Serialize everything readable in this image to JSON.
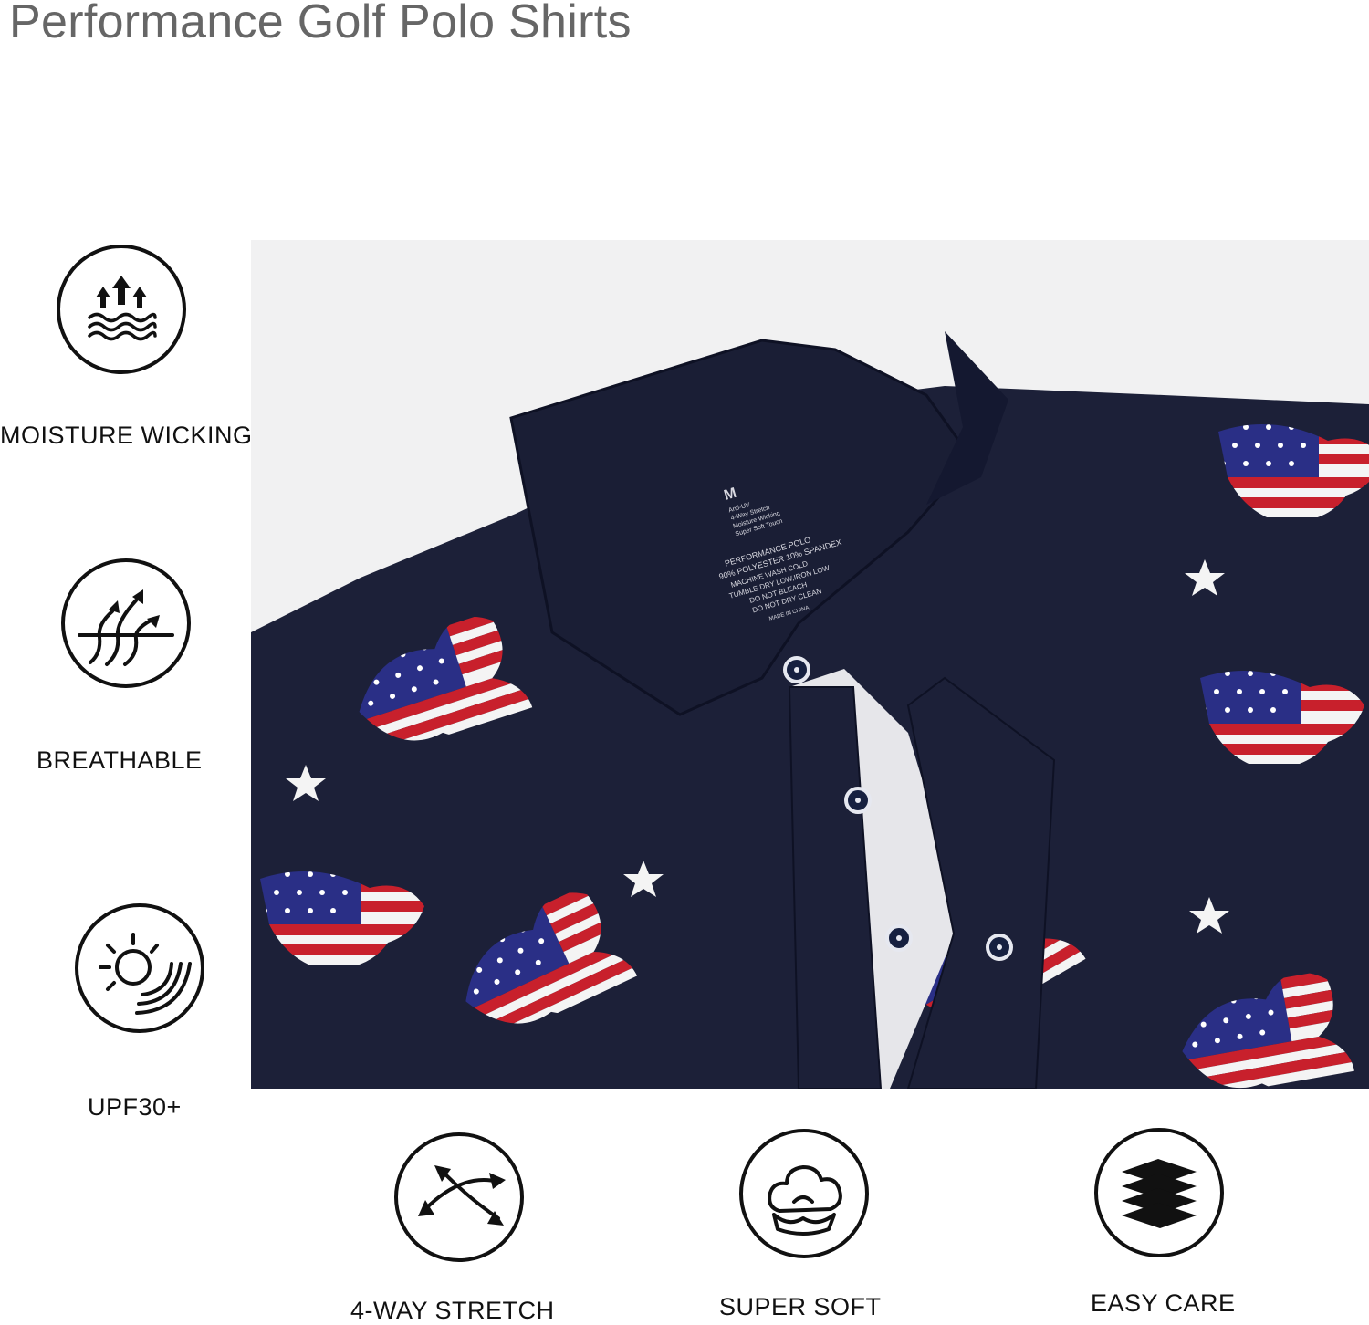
{
  "page": {
    "title": "Performance Golf Polo Shirts"
  },
  "features": {
    "moisture_wicking": {
      "label": "MOISTURE WICKING",
      "icon": "moisture-wicking-icon"
    },
    "breathable": {
      "label": "BREATHABLE",
      "icon": "breathable-icon"
    },
    "upf": {
      "label": "UPF30+",
      "icon": "sun-protection-icon"
    },
    "stretch": {
      "label": "4-WAY STRETCH",
      "icon": "stretch-arrows-icon"
    },
    "soft": {
      "label": "SUPER SOFT",
      "icon": "cotton-icon"
    },
    "easy_care": {
      "label": "EASY CARE",
      "icon": "layers-icon"
    }
  },
  "photo": {
    "subject": "navy-polo-with-flag-eagle-print",
    "tag": {
      "size": "M",
      "lines": [
        "Anti-UV",
        "4-Way Stretch",
        "Moisture Wicking",
        "Super Soft Touch",
        "PERFORMANCE POLO",
        "90% POLYESTER  10% SPANDEX",
        "MACHINE WASH COLD",
        "TUMBLE DRY LOW,IRON LOW",
        "DO NOT BLEACH",
        "DO NOT DRY CLEAN",
        "MADE IN CHINA"
      ]
    }
  },
  "colors": {
    "shirt_navy": "#1c2038",
    "flag_red": "#c8202c",
    "flag_blue": "#2a2f86",
    "title_gray": "#666666"
  }
}
